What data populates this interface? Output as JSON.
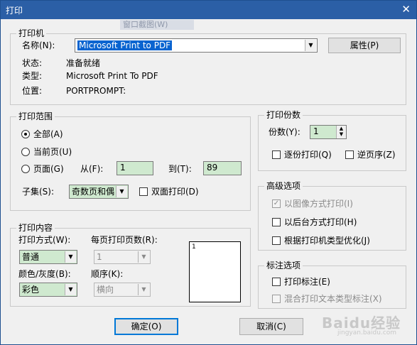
{
  "window": {
    "title": "打印",
    "close_glyph": "✕",
    "ghost_text": "窗口截图(W)"
  },
  "printer_group": {
    "legend": "打印机",
    "name_label": "名称(N):",
    "name_value": "Microsoft Print to PDF",
    "properties_button": "属性(P)",
    "status_label": "状态:",
    "status_value": "准备就绪",
    "type_label": "类型:",
    "type_value": "Microsoft Print To PDF",
    "location_label": "位置:",
    "location_value": "PORTPROMPT:"
  },
  "range_group": {
    "legend": "打印范围",
    "all_label": "全部(A)",
    "current_label": "当前页(U)",
    "pages_label": "页面(G)",
    "from_label": "从(F):",
    "from_value": "1",
    "to_label": "到(T):",
    "to_value": "89",
    "subset_label": "子集(S):",
    "subset_value": "奇数页和偶",
    "duplex_label": "双面打印(D)"
  },
  "content_group": {
    "legend": "打印内容",
    "method_label": "打印方式(W):",
    "method_value": "普通",
    "pages_per_sheet_label": "每页打印页数(R):",
    "pages_per_sheet_value": "1",
    "color_label": "颜色/灰度(B):",
    "color_value": "彩色",
    "order_label": "顺序(K):",
    "order_value": "横向",
    "preview_number": "1"
  },
  "copies_group": {
    "legend": "打印份数",
    "copies_label": "份数(Y):",
    "copies_value": "1",
    "collate_label": "逐份打印(Q)",
    "reverse_label": "逆页序(Z)"
  },
  "advanced_group": {
    "legend": "高级选项",
    "image_label": "以图像方式打印(I)",
    "background_label": "以后台方式打印(H)",
    "optimize_label": "根据打印机类型优化(J)"
  },
  "annotation_group": {
    "legend": "标注选项",
    "print_annot_label": "打印标注(E)",
    "mixed_label": "混合打印文本类型标注(X)"
  },
  "footer": {
    "ok_label": "确定(O)",
    "cancel_label": "取消(C)"
  },
  "watermark": {
    "brand": "Baidu经验",
    "url": "jingyan.baidu.com"
  }
}
